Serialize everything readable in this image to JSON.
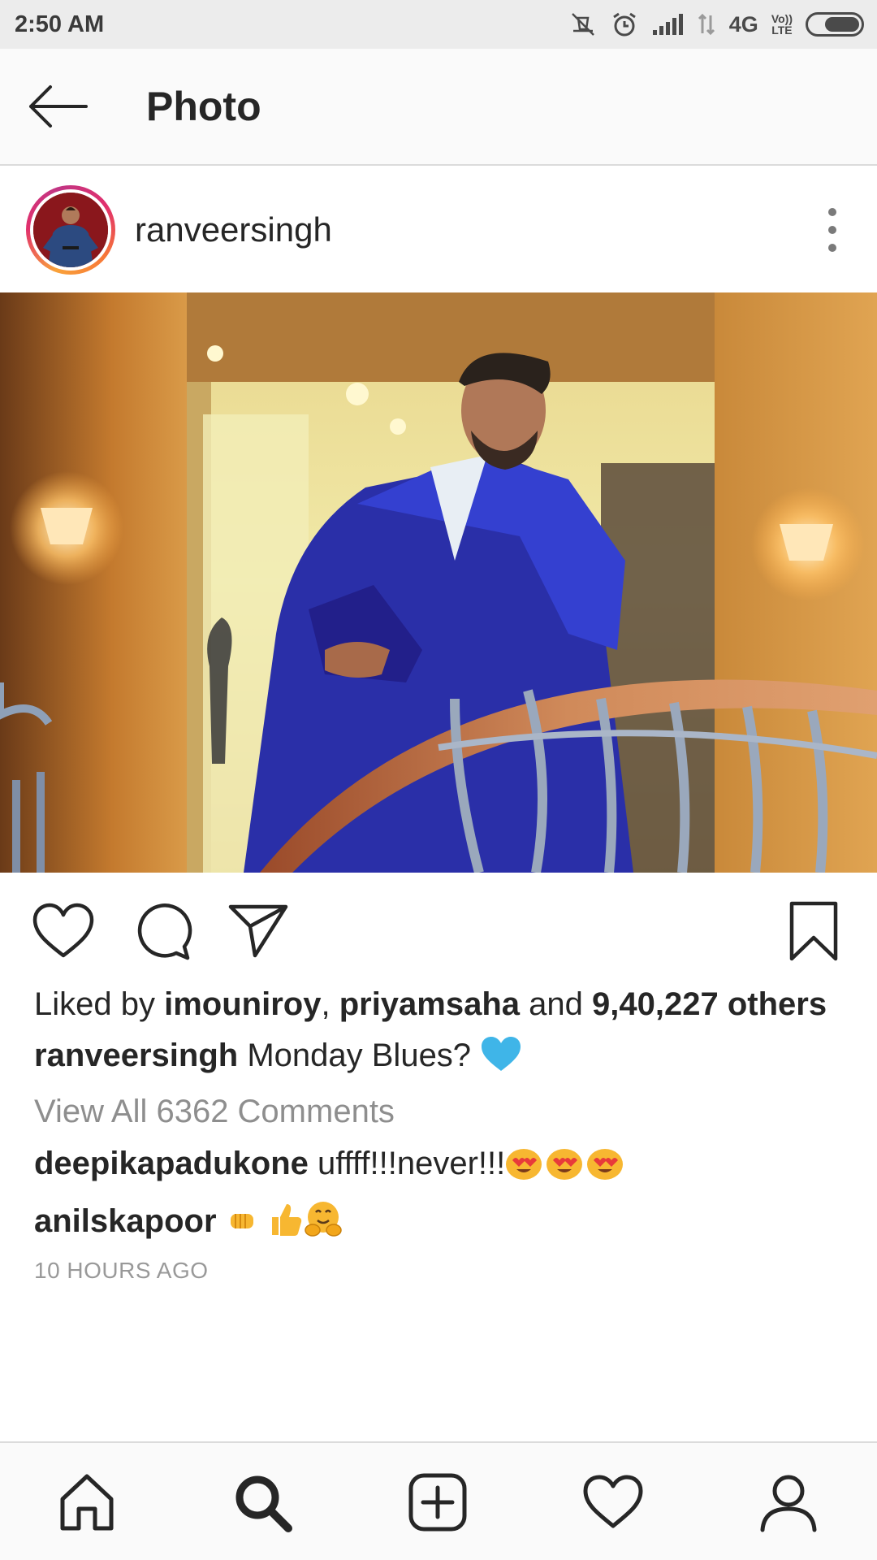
{
  "status_bar": {
    "time": "2:50 AM",
    "network": "4G",
    "volte": "Vo)) LTE",
    "battery_level": 0.7
  },
  "header": {
    "title": "Photo",
    "back_icon": "arrow-left-icon"
  },
  "post": {
    "username": "ranveersingh",
    "more_icon": "more-vertical-icon",
    "liked_by_prefix": "Liked by ",
    "liker1": "imouniroy",
    "liker_separator": ", ",
    "liker2": "priyamsaha",
    "and_text": " and ",
    "others": "9,40,227 others",
    "caption_user": "ranveersingh",
    "caption_text": " Monday Blues? ",
    "view_comments": "View All 6362 Comments",
    "comments": [
      {
        "user": "deepikapadukone",
        "text": " uffff!!!never!!!"
      },
      {
        "user": "anilskapoor",
        "text": " "
      }
    ],
    "timestamp": "10 HOURS AGO"
  },
  "actions": {
    "like_icon": "heart-outline-icon",
    "comment_icon": "comment-icon",
    "share_icon": "send-icon",
    "save_icon": "bookmark-icon"
  },
  "bottom_nav": {
    "items": [
      "home-icon",
      "search-icon",
      "add-post-icon",
      "activity-heart-icon",
      "profile-icon"
    ]
  },
  "colors": {
    "text": "#262626",
    "muted": "#8e8e8e",
    "heart_blue": "#3fb5e8"
  }
}
